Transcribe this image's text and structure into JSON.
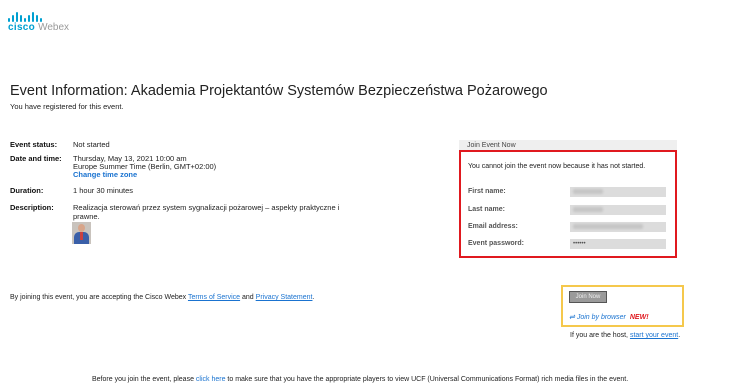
{
  "logo": {
    "cisco": "cisco",
    "webex": "Webex"
  },
  "page": {
    "title": "Event Information: Akademia Projektantów Systemów Bezpieczeństwa Pożarowego",
    "subtitle": "You have registered for this event."
  },
  "info": {
    "status_label": "Event status:",
    "status_value": "Not started",
    "datetime_label": "Date and time:",
    "datetime_line1": "Thursday, May 13, 2021 10:00 am",
    "datetime_line2": "Europe Summer Time (Berlin, GMT+02:00)",
    "change_time_zone": "Change time zone",
    "duration_label": "Duration:",
    "duration_value": "1 hour 30 minutes",
    "description_label": "Description:",
    "description_line1": "Realizacja sterowań przez system sygnalizacji pożarowej – aspekty praktyczne i",
    "description_line2": "prawne."
  },
  "join": {
    "header": "Join Event Now",
    "message": "You cannot join the event now because it has not started.",
    "first_name_label": "First name:",
    "last_name_label": "Last name:",
    "email_label": "Email address:",
    "password_label": "Event password:",
    "password_value": "••••••",
    "join_now_button": "Join Now",
    "join_browser": "Join by browser",
    "new_badge": "NEW!",
    "host_prefix": "If you are the host, ",
    "host_link": "start your event",
    "host_suffix": "."
  },
  "terms": {
    "prefix": "By joining this event, you are accepting the Cisco Webex ",
    "tos": "Terms of Service",
    "and": " and ",
    "privacy": "Privacy Statement",
    "suffix": "."
  },
  "footer": {
    "prefix": "Before you join the event, please ",
    "link": "click here",
    "suffix": " to make sure that you have the appropriate players to view UCF (Universal Communications Format) rich media files in the event."
  },
  "colors": {
    "accent": "#1a73d0",
    "error_border": "#e0191f",
    "highlight_border": "#f5c84c",
    "logo": "#00a0d1"
  }
}
